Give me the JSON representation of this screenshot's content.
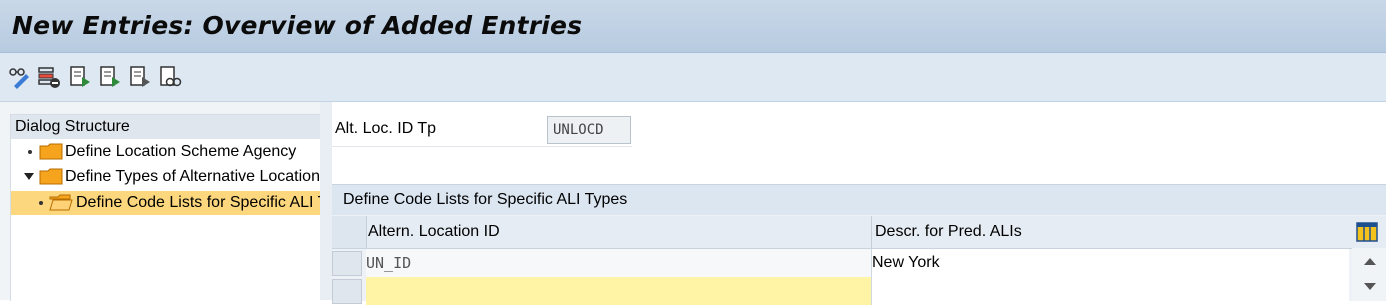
{
  "header": {
    "title": "New Entries: Overview of Added Entries"
  },
  "toolbar": {
    "buttons": [
      "glasses-pencil-icon",
      "delete-row-icon",
      "prev-entry-icon",
      "next-entry-icon",
      "copy-entry-icon",
      "details-icon"
    ]
  },
  "dialog_structure": {
    "title": "Dialog Structure",
    "items": [
      {
        "label": "Define Location Scheme Agency"
      },
      {
        "label": "Define Types of Alternative Locations"
      },
      {
        "label": "Define Code Lists for Specific ALI Types"
      }
    ]
  },
  "field": {
    "label": "Alt. Loc. ID Tp",
    "value": "UNLOCD"
  },
  "table": {
    "title": "Define Code Lists for Specific ALI Types",
    "columns": [
      "Altern. Location ID",
      "Descr. for Pred. ALIs"
    ],
    "rows": [
      [
        "UN_ID",
        "New York"
      ],
      [
        "",
        ""
      ]
    ]
  },
  "colors": {
    "title_bar": "#b7cbe0",
    "selection": "#fcd77d",
    "new_row": "#fff4a6",
    "folder": "#f5a623"
  }
}
